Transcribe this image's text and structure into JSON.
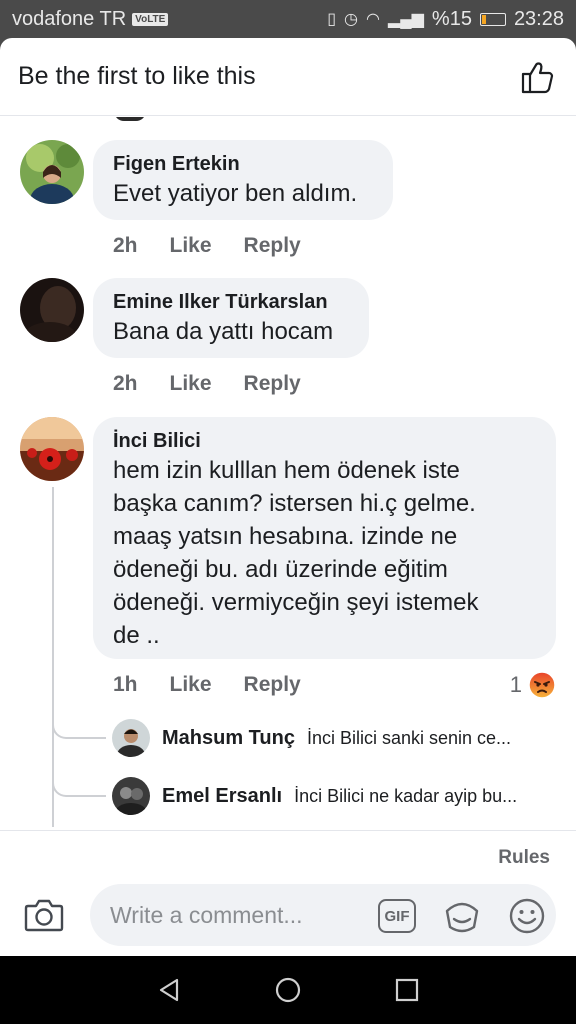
{
  "status_bar": {
    "carrier": "vodafone TR",
    "volte": "VoLTE",
    "battery_percent": "%15",
    "battery_level": 0.15,
    "time": "23:28"
  },
  "header": {
    "title": "Be the first to like this",
    "like_icon": "thumbs-up-icon"
  },
  "comments": [
    {
      "author": "Figen Ertekin",
      "text": "Evet yatiyor ben aldım.",
      "time": "2h",
      "like_label": "Like",
      "reply_label": "Reply"
    },
    {
      "author": "Emine Ilker Türkarslan",
      "text": "Bana da yattı hocam",
      "time": "2h",
      "like_label": "Like",
      "reply_label": "Reply"
    },
    {
      "author": "İnci Bilici",
      "text_lines": [
        "hem izin kulllan hem ödenek iste",
        "başka canım? istersen hi.ç gelme.",
        "maaş yatsın hesabına. izinde ne",
        "ödeneği bu. adı üzerinde eğitim",
        "ödeneği. vermiyceğin şeyi istemek",
        "de .."
      ],
      "time": "1h",
      "like_label": "Like",
      "reply_label": "Reply",
      "reaction_count": "1",
      "reaction_icon": "angry-reaction-icon"
    }
  ],
  "replies": [
    {
      "author": "Mahsum Tunç",
      "preview": "İnci Bilici sanki senin ce..."
    },
    {
      "author": "Emel Ersanlı",
      "preview": "İnci Bilici ne kadar ayip bu..."
    }
  ],
  "footer": {
    "rules_label": "Rules",
    "comment_placeholder": "Write a comment...",
    "gif_label": "GIF"
  },
  "colors": {
    "bubble_bg": "#f0f2f5",
    "secondary_text": "#65676b",
    "primary_text": "#1c1e21"
  }
}
